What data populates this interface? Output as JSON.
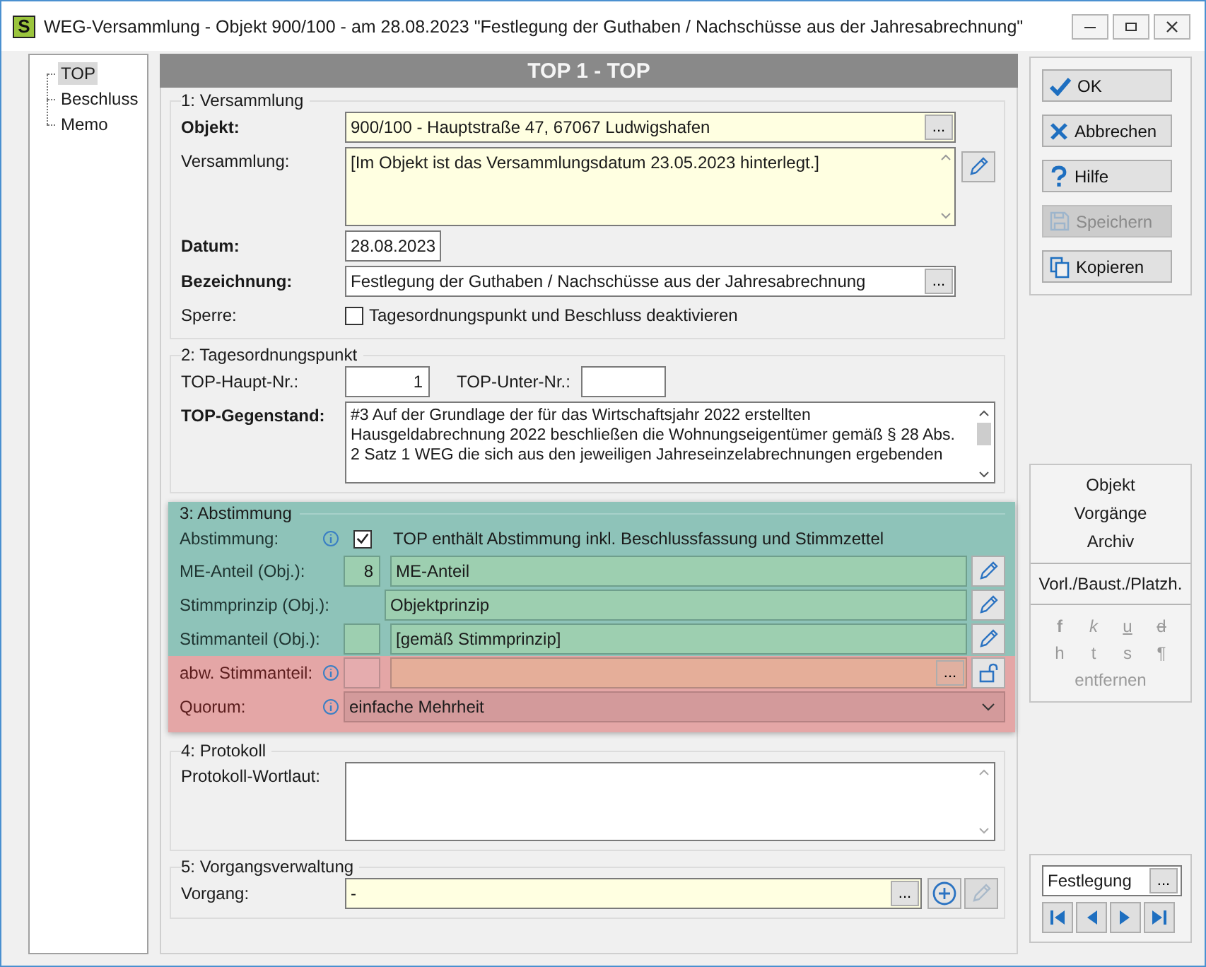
{
  "window": {
    "icon_letter": "S",
    "title": "WEG-Versammlung - Objekt 900/100 - am 28.08.2023 \"Festlegung der Guthaben / Nachschüsse aus der Jahresabrechnung\""
  },
  "tree": [
    {
      "label": "TOP",
      "selected": true
    },
    {
      "label": "Beschluss",
      "selected": false
    },
    {
      "label": "Memo",
      "selected": false
    }
  ],
  "header": "TOP 1 - TOP",
  "versammlung": {
    "title": "1: Versammlung",
    "objekt": {
      "label": "Objekt:",
      "required": true,
      "value": "900/100 - Hauptstraße 47, 67067 Ludwigshafen",
      "browse": "..."
    },
    "versammlung": {
      "label": "Versammlung:",
      "required": false,
      "value": "[Im Objekt ist das Versammlungsdatum 23.05.2023 hinterlegt.]"
    },
    "datum": {
      "label": "Datum:",
      "required": true,
      "value": "28.08.2023"
    },
    "bezeichnung": {
      "label": "Bezeichnung:",
      "required": true,
      "value": "Festlegung der Guthaben / Nachschüsse aus der Jahresabrechnung",
      "browse": "..."
    },
    "sperre": {
      "label": "Sperre:",
      "checkbox_label": "Tagesordnungspunkt und Beschluss deaktivieren",
      "checked": false
    }
  },
  "tagesordnungspunkt": {
    "title": "2: Tagesordnungspunkt",
    "haupt_nr": {
      "label": "TOP-Haupt-Nr.:",
      "value": "1"
    },
    "unter_nr": {
      "label": "TOP-Unter-Nr.:"
    },
    "gegenstand": {
      "label": "TOP-Gegenstand:",
      "required": true,
      "value": "#3 Auf der Grundlage der für das Wirtschaftsjahr 2022 erstellten Hausgeldabrechnung 2022 beschließen die Wohnungseigentümer gemäß § 28 Abs. 2 Satz 1 WEG die sich aus den jeweiligen Jahreseinzelabrechnungen ergebenden"
    }
  },
  "abstimmung": {
    "title": "3: Abstimmung",
    "abstimmung": {
      "label": "Abstimmung:",
      "checked": true,
      "checkbox_label": "TOP enthält Abstimmung inkl. Beschlussfassung und Stimmzettel"
    },
    "me_anteil": {
      "label": "ME-Anteil (Obj.):",
      "number": "8",
      "value": "ME-Anteil"
    },
    "stimmprinzip": {
      "label": "Stimmprinzip (Obj.):",
      "value": "Objektprinzip"
    },
    "stimmanteil": {
      "label": "Stimmanteil (Obj.):",
      "value": "[gemäß Stimmprinzip]"
    },
    "abw_stimmanteil": {
      "label": "abw. Stimmanteil:",
      "browse": "..."
    },
    "quorum": {
      "label": "Quorum:",
      "value": "einfache Mehrheit"
    }
  },
  "protokoll": {
    "title": "4: Protokoll",
    "wortlaut": {
      "label": "Protokoll-Wortlaut:"
    }
  },
  "vorgangsverwaltung": {
    "title": "5: Vorgangsverwaltung",
    "vorgang": {
      "label": "Vorgang:",
      "value": "-",
      "browse": "..."
    }
  },
  "buttons": [
    {
      "label": "OK",
      "kind": "ok",
      "disabled": false
    },
    {
      "label": "Abbrechen",
      "kind": "cancel",
      "disabled": false
    },
    {
      "label": "Hilfe",
      "kind": "help",
      "disabled": false
    },
    {
      "label": "Speichern",
      "kind": "save",
      "disabled": true
    },
    {
      "label": "Kopieren",
      "kind": "copy",
      "disabled": false
    }
  ],
  "links": [
    "Objekt",
    "Vorgänge",
    "Archiv"
  ],
  "template_button": "Vorl./Baust./Platzh.",
  "formatting": {
    "disabled": true,
    "keys": [
      {
        "label": "f",
        "kind": "bold"
      },
      {
        "label": "k",
        "kind": "italic"
      },
      {
        "label": "u",
        "kind": "underline"
      },
      {
        "label": "d",
        "kind": "strike"
      },
      {
        "label": "h",
        "kind": "plain"
      },
      {
        "label": "t",
        "kind": "plain"
      },
      {
        "label": "s",
        "kind": "plain"
      },
      {
        "label": "¶",
        "kind": "plain"
      }
    ],
    "remove": "entfernen"
  },
  "record_nav": {
    "value": "Festlegung",
    "browse": "..."
  }
}
